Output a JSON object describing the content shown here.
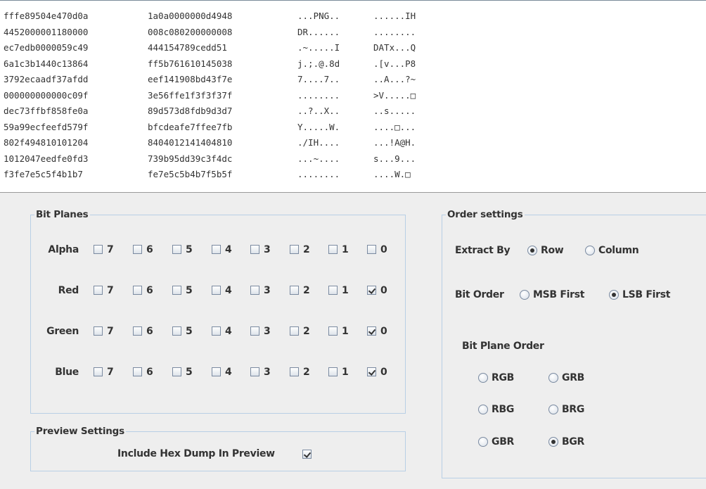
{
  "hex_dump": {
    "rows": [
      {
        "h1": "fffe89504e470d0a",
        "h2": "1a0a0000000d4948",
        "a1": "...PNG..",
        "a2": "......IH"
      },
      {
        "h1": "4452000001180000",
        "h2": "008c080200000008",
        "a1": "DR......",
        "a2": "........"
      },
      {
        "h1": "ec7edb0000059c49",
        "h2": "444154789cedd51",
        "a1": ".~.....I",
        "a2": "DATx...Q"
      },
      {
        "h1": "6a1c3b1440c13864",
        "h2": "ff5b761610145038",
        "a1": "j.;.@.8d",
        "a2": ".[v...P8"
      },
      {
        "h1": "3792ecaadf37afdd",
        "h2": "eef141908bd43f7e",
        "a1": "7....7..",
        "a2": "..A...?~"
      },
      {
        "h1": "000000000000c09f",
        "h2": "3e56ffe1f3f3f37f",
        "a1": "........",
        "a2": ">V.....□"
      },
      {
        "h1": "dec73ffbf858fe0a",
        "h2": "89d573d8fdb9d3d7",
        "a1": "..?..X..",
        "a2": "..s....."
      },
      {
        "h1": "59a99ecfeefd579f",
        "h2": "bfcdeafe7ffee7fb",
        "a1": "Y.....W.",
        "a2": "....□..."
      },
      {
        "h1": "802f494810101204",
        "h2": "8404012141404810",
        "a1": "./IH....",
        "a2": "...!A@H."
      },
      {
        "h1": "1012047eedfe0fd3",
        "h2": "739b95dd39c3f4dc",
        "a1": "...~....",
        "a2": "s...9..."
      },
      {
        "h1": "f3fe7e5c5f4b1b7",
        "h2": "fe7e5c5b4b7f5b5f",
        "a1": "........",
        "a2": "....W.□"
      }
    ]
  },
  "bit_planes": {
    "title": "Bit Planes",
    "channels": [
      {
        "name": "Alpha",
        "checked": [
          false,
          false,
          false,
          false,
          false,
          false,
          false,
          false
        ]
      },
      {
        "name": "Red",
        "checked": [
          false,
          false,
          false,
          false,
          false,
          false,
          false,
          true
        ]
      },
      {
        "name": "Green",
        "checked": [
          false,
          false,
          false,
          false,
          false,
          false,
          false,
          true
        ]
      },
      {
        "name": "Blue",
        "checked": [
          false,
          false,
          false,
          false,
          false,
          false,
          false,
          true
        ]
      }
    ],
    "bits": [
      "7",
      "6",
      "5",
      "4",
      "3",
      "2",
      "1",
      "0"
    ]
  },
  "preview": {
    "title": "Preview Settings",
    "include_hex_label": "Include Hex Dump In Preview",
    "include_hex_checked": true
  },
  "order": {
    "title": "Order settings",
    "extract_by_label": "Extract By",
    "extract_options": [
      {
        "label": "Row",
        "selected": true
      },
      {
        "label": "Column",
        "selected": false
      }
    ],
    "bit_order_label": "Bit Order",
    "bit_order_options": [
      {
        "label": "MSB First",
        "selected": false
      },
      {
        "label": "LSB First",
        "selected": true
      }
    ],
    "plane_order_label": "Bit Plane Order",
    "plane_order_options": [
      {
        "label": "RGB",
        "selected": false
      },
      {
        "label": "GRB",
        "selected": false
      },
      {
        "label": "RBG",
        "selected": false
      },
      {
        "label": "BRG",
        "selected": false
      },
      {
        "label": "GBR",
        "selected": false
      },
      {
        "label": "BGR",
        "selected": true
      }
    ]
  }
}
